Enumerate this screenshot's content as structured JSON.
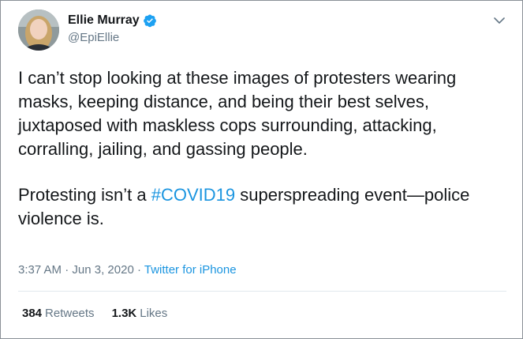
{
  "user": {
    "display_name": "Ellie Murray",
    "handle": "@EpiEllie",
    "verified": true
  },
  "tweet": {
    "paragraph1": "I can’t stop looking at these images of protesters wearing masks, keeping distance, and being their best selves, juxtaposed with maskless cops surrounding, attacking, corralling, jailing, and gassing people.",
    "paragraph2_before": "Protesting isn’t a ",
    "hashtag": "#COVID19",
    "paragraph2_after": " superspreading event—police violence is."
  },
  "meta": {
    "time": "3:37 AM",
    "separator1": " · ",
    "date": "Jun 3, 2020",
    "separator2": " · ",
    "source": "Twitter for iPhone"
  },
  "stats": {
    "retweets_count": "384",
    "retweets_label": "Retweets",
    "likes_count": "1.3K",
    "likes_label": "Likes"
  },
  "colors": {
    "link": "#1b95e0",
    "verified": "#1da1f2",
    "secondary_text": "#657786",
    "primary_text": "#14171a"
  },
  "icons": {
    "verified": "verified-badge-icon",
    "menu": "chevron-down-icon"
  }
}
